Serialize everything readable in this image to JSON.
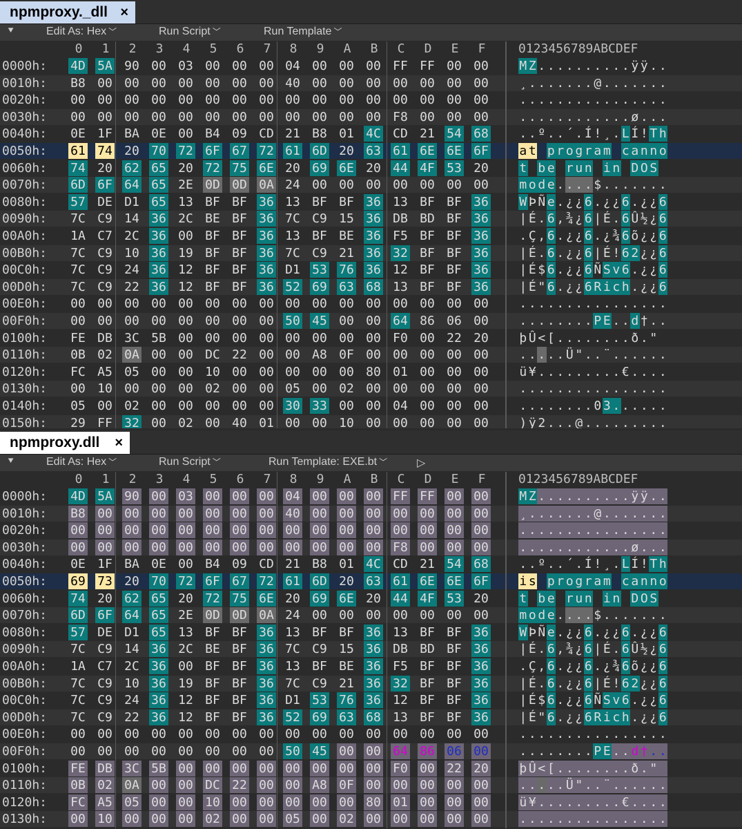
{
  "panes": [
    {
      "tab_label": "npmproxy._dll",
      "close": "×",
      "toolbar": {
        "edit_as": "Edit As: Hex",
        "run_script": "Run Script",
        "run_template": "Run Template"
      },
      "col_headers": [
        "0",
        "1",
        "2",
        "3",
        "4",
        "5",
        "6",
        "7",
        "8",
        "9",
        "A",
        "B",
        "C",
        "D",
        "E",
        "F"
      ],
      "ascii_header": "0123456789ABCDEF",
      "rows": [
        {
          "addr": "0000h:",
          "bytes": [
            "4D",
            "5A",
            "90",
            "00",
            "03",
            "00",
            "00",
            "00",
            "04",
            "00",
            "00",
            "00",
            "FF",
            "FF",
            "00",
            "00"
          ],
          "ascii": "MZ..........ÿÿ.."
        },
        {
          "addr": "0010h:",
          "bytes": [
            "B8",
            "00",
            "00",
            "00",
            "00",
            "00",
            "00",
            "00",
            "40",
            "00",
            "00",
            "00",
            "00",
            "00",
            "00",
            "00"
          ],
          "ascii": "¸.......@......."
        },
        {
          "addr": "0020h:",
          "bytes": [
            "00",
            "00",
            "00",
            "00",
            "00",
            "00",
            "00",
            "00",
            "00",
            "00",
            "00",
            "00",
            "00",
            "00",
            "00",
            "00"
          ],
          "ascii": "................"
        },
        {
          "addr": "0030h:",
          "bytes": [
            "00",
            "00",
            "00",
            "00",
            "00",
            "00",
            "00",
            "00",
            "00",
            "00",
            "00",
            "00",
            "F8",
            "00",
            "00",
            "00"
          ],
          "ascii": "............ø..."
        },
        {
          "addr": "0040h:",
          "bytes": [
            "0E",
            "1F",
            "BA",
            "0E",
            "00",
            "B4",
            "09",
            "CD",
            "21",
            "B8",
            "01",
            "4C",
            "CD",
            "21",
            "54",
            "68"
          ],
          "ascii": "..º..´.Í!¸.LÍ!Th"
        },
        {
          "addr": "0050h:",
          "bytes": [
            "61",
            "74",
            "20",
            "70",
            "72",
            "6F",
            "67",
            "72",
            "61",
            "6D",
            "20",
            "63",
            "61",
            "6E",
            "6E",
            "6F"
          ],
          "ascii": "at program canno"
        },
        {
          "addr": "0060h:",
          "bytes": [
            "74",
            "20",
            "62",
            "65",
            "20",
            "72",
            "75",
            "6E",
            "20",
            "69",
            "6E",
            "20",
            "44",
            "4F",
            "53",
            "20"
          ],
          "ascii": "t be run in DOS "
        },
        {
          "addr": "0070h:",
          "bytes": [
            "6D",
            "6F",
            "64",
            "65",
            "2E",
            "0D",
            "0D",
            "0A",
            "24",
            "00",
            "00",
            "00",
            "00",
            "00",
            "00",
            "00"
          ],
          "ascii": "mode....$......."
        },
        {
          "addr": "0080h:",
          "bytes": [
            "57",
            "DE",
            "D1",
            "65",
            "13",
            "BF",
            "BF",
            "36",
            "13",
            "BF",
            "BF",
            "36",
            "13",
            "BF",
            "BF",
            "36"
          ],
          "ascii": "WÞÑe.¿¿6.¿¿6.¿¿6"
        },
        {
          "addr": "0090h:",
          "bytes": [
            "7C",
            "C9",
            "14",
            "36",
            "2C",
            "BE",
            "BF",
            "36",
            "7C",
            "C9",
            "15",
            "36",
            "DB",
            "BD",
            "BF",
            "36"
          ],
          "ascii": "|É.6,¾¿6|É.6Û½¿6"
        },
        {
          "addr": "00A0h:",
          "bytes": [
            "1A",
            "C7",
            "2C",
            "36",
            "00",
            "BF",
            "BF",
            "36",
            "13",
            "BF",
            "BE",
            "36",
            "F5",
            "BF",
            "BF",
            "36"
          ],
          "ascii": ".Ç,6.¿¿6.¿¾6õ¿¿6"
        },
        {
          "addr": "00B0h:",
          "bytes": [
            "7C",
            "C9",
            "10",
            "36",
            "19",
            "BF",
            "BF",
            "36",
            "7C",
            "C9",
            "21",
            "36",
            "32",
            "BF",
            "BF",
            "36"
          ],
          "ascii": "|É.6.¿¿6|É!62¿¿6"
        },
        {
          "addr": "00C0h:",
          "bytes": [
            "7C",
            "C9",
            "24",
            "36",
            "12",
            "BF",
            "BF",
            "36",
            "D1",
            "53",
            "76",
            "36",
            "12",
            "BF",
            "BF",
            "36"
          ],
          "ascii": "|É$6.¿¿6ÑSv6.¿¿6"
        },
        {
          "addr": "00D0h:",
          "bytes": [
            "7C",
            "C9",
            "22",
            "36",
            "12",
            "BF",
            "BF",
            "36",
            "52",
            "69",
            "63",
            "68",
            "13",
            "BF",
            "BF",
            "36"
          ],
          "ascii": "|É\"6.¿¿6Rich.¿¿6"
        },
        {
          "addr": "00E0h:",
          "bytes": [
            "00",
            "00",
            "00",
            "00",
            "00",
            "00",
            "00",
            "00",
            "00",
            "00",
            "00",
            "00",
            "00",
            "00",
            "00",
            "00"
          ],
          "ascii": "................"
        },
        {
          "addr": "00F0h:",
          "bytes": [
            "00",
            "00",
            "00",
            "00",
            "00",
            "00",
            "00",
            "00",
            "50",
            "45",
            "00",
            "00",
            "64",
            "86",
            "06",
            "00"
          ],
          "ascii": "........PE..d†.."
        },
        {
          "addr": "0100h:",
          "bytes": [
            "FE",
            "DB",
            "3C",
            "5B",
            "00",
            "00",
            "00",
            "00",
            "00",
            "00",
            "00",
            "00",
            "F0",
            "00",
            "22",
            "20"
          ],
          "ascii": "þÛ<[........ð.\" "
        },
        {
          "addr": "0110h:",
          "bytes": [
            "0B",
            "02",
            "0A",
            "00",
            "00",
            "DC",
            "22",
            "00",
            "00",
            "A8",
            "0F",
            "00",
            "00",
            "00",
            "00",
            "00"
          ],
          "ascii": ".....Ü\"..¨......"
        },
        {
          "addr": "0120h:",
          "bytes": [
            "FC",
            "A5",
            "05",
            "00",
            "00",
            "10",
            "00",
            "00",
            "00",
            "00",
            "00",
            "80",
            "01",
            "00",
            "00",
            "00"
          ],
          "ascii": "ü¥.........€...."
        },
        {
          "addr": "0130h:",
          "bytes": [
            "00",
            "10",
            "00",
            "00",
            "00",
            "02",
            "00",
            "00",
            "05",
            "00",
            "02",
            "00",
            "00",
            "00",
            "00",
            "00"
          ],
          "ascii": "................"
        },
        {
          "addr": "0140h:",
          "bytes": [
            "05",
            "00",
            "02",
            "00",
            "00",
            "00",
            "00",
            "00",
            "30",
            "33",
            "00",
            "00",
            "04",
            "00",
            "00",
            "00"
          ],
          "ascii": "........03......"
        },
        {
          "addr": "0150h:",
          "bytes": [
            "29",
            "FF",
            "32",
            "00",
            "02",
            "00",
            "40",
            "01",
            "00",
            "00",
            "10",
            "00",
            "00",
            "00",
            "00",
            "00"
          ],
          "ascii": ")ÿ2...@........."
        }
      ]
    },
    {
      "tab_label": "npmproxy.dll",
      "close": "×",
      "toolbar": {
        "edit_as": "Edit As: Hex",
        "run_script": "Run Script",
        "run_template": "Run Template: EXE.bt",
        "play": "▷"
      },
      "col_headers": [
        "0",
        "1",
        "2",
        "3",
        "4",
        "5",
        "6",
        "7",
        "8",
        "9",
        "A",
        "B",
        "C",
        "D",
        "E",
        "F"
      ],
      "ascii_header": "0123456789ABCDEF",
      "rows": [
        {
          "addr": "0000h:",
          "bytes": [
            "4D",
            "5A",
            "90",
            "00",
            "03",
            "00",
            "00",
            "00",
            "04",
            "00",
            "00",
            "00",
            "FF",
            "FF",
            "00",
            "00"
          ],
          "ascii": "MZ..........ÿÿ.."
        },
        {
          "addr": "0010h:",
          "bytes": [
            "B8",
            "00",
            "00",
            "00",
            "00",
            "00",
            "00",
            "00",
            "40",
            "00",
            "00",
            "00",
            "00",
            "00",
            "00",
            "00"
          ],
          "ascii": "¸.......@......."
        },
        {
          "addr": "0020h:",
          "bytes": [
            "00",
            "00",
            "00",
            "00",
            "00",
            "00",
            "00",
            "00",
            "00",
            "00",
            "00",
            "00",
            "00",
            "00",
            "00",
            "00"
          ],
          "ascii": "................"
        },
        {
          "addr": "0030h:",
          "bytes": [
            "00",
            "00",
            "00",
            "00",
            "00",
            "00",
            "00",
            "00",
            "00",
            "00",
            "00",
            "00",
            "F8",
            "00",
            "00",
            "00"
          ],
          "ascii": "............ø..."
        },
        {
          "addr": "0040h:",
          "bytes": [
            "0E",
            "1F",
            "BA",
            "0E",
            "00",
            "B4",
            "09",
            "CD",
            "21",
            "B8",
            "01",
            "4C",
            "CD",
            "21",
            "54",
            "68"
          ],
          "ascii": "..º..´.Í!¸.LÍ!Th"
        },
        {
          "addr": "0050h:",
          "bytes": [
            "69",
            "73",
            "20",
            "70",
            "72",
            "6F",
            "67",
            "72",
            "61",
            "6D",
            "20",
            "63",
            "61",
            "6E",
            "6E",
            "6F"
          ],
          "ascii": "is program canno"
        },
        {
          "addr": "0060h:",
          "bytes": [
            "74",
            "20",
            "62",
            "65",
            "20",
            "72",
            "75",
            "6E",
            "20",
            "69",
            "6E",
            "20",
            "44",
            "4F",
            "53",
            "20"
          ],
          "ascii": "t be run in DOS "
        },
        {
          "addr": "0070h:",
          "bytes": [
            "6D",
            "6F",
            "64",
            "65",
            "2E",
            "0D",
            "0D",
            "0A",
            "24",
            "00",
            "00",
            "00",
            "00",
            "00",
            "00",
            "00"
          ],
          "ascii": "mode....$......."
        },
        {
          "addr": "0080h:",
          "bytes": [
            "57",
            "DE",
            "D1",
            "65",
            "13",
            "BF",
            "BF",
            "36",
            "13",
            "BF",
            "BF",
            "36",
            "13",
            "BF",
            "BF",
            "36"
          ],
          "ascii": "WÞÑe.¿¿6.¿¿6.¿¿6"
        },
        {
          "addr": "0090h:",
          "bytes": [
            "7C",
            "C9",
            "14",
            "36",
            "2C",
            "BE",
            "BF",
            "36",
            "7C",
            "C9",
            "15",
            "36",
            "DB",
            "BD",
            "BF",
            "36"
          ],
          "ascii": "|É.6,¾¿6|É.6Û½¿6"
        },
        {
          "addr": "00A0h:",
          "bytes": [
            "1A",
            "C7",
            "2C",
            "36",
            "00",
            "BF",
            "BF",
            "36",
            "13",
            "BF",
            "BE",
            "36",
            "F5",
            "BF",
            "BF",
            "36"
          ],
          "ascii": ".Ç,6.¿¿6.¿¾6õ¿¿6"
        },
        {
          "addr": "00B0h:",
          "bytes": [
            "7C",
            "C9",
            "10",
            "36",
            "19",
            "BF",
            "BF",
            "36",
            "7C",
            "C9",
            "21",
            "36",
            "32",
            "BF",
            "BF",
            "36"
          ],
          "ascii": "|É.6.¿¿6|É!62¿¿6"
        },
        {
          "addr": "00C0h:",
          "bytes": [
            "7C",
            "C9",
            "24",
            "36",
            "12",
            "BF",
            "BF",
            "36",
            "D1",
            "53",
            "76",
            "36",
            "12",
            "BF",
            "BF",
            "36"
          ],
          "ascii": "|É$6.¿¿6ÑSv6.¿¿6"
        },
        {
          "addr": "00D0h:",
          "bytes": [
            "7C",
            "C9",
            "22",
            "36",
            "12",
            "BF",
            "BF",
            "36",
            "52",
            "69",
            "63",
            "68",
            "13",
            "BF",
            "BF",
            "36"
          ],
          "ascii": "|É\"6.¿¿6Rich.¿¿6"
        },
        {
          "addr": "00E0h:",
          "bytes": [
            "00",
            "00",
            "00",
            "00",
            "00",
            "00",
            "00",
            "00",
            "00",
            "00",
            "00",
            "00",
            "00",
            "00",
            "00",
            "00"
          ],
          "ascii": "................"
        },
        {
          "addr": "00F0h:",
          "bytes": [
            "00",
            "00",
            "00",
            "00",
            "00",
            "00",
            "00",
            "00",
            "50",
            "45",
            "00",
            "00",
            "64",
            "86",
            "06",
            "00"
          ],
          "ascii": "........PE..d†.."
        },
        {
          "addr": "0100h:",
          "bytes": [
            "FE",
            "DB",
            "3C",
            "5B",
            "00",
            "00",
            "00",
            "00",
            "00",
            "00",
            "00",
            "00",
            "F0",
            "00",
            "22",
            "20"
          ],
          "ascii": "þÛ<[........ð.\" "
        },
        {
          "addr": "0110h:",
          "bytes": [
            "0B",
            "02",
            "0A",
            "00",
            "00",
            "DC",
            "22",
            "00",
            "00",
            "A8",
            "0F",
            "00",
            "00",
            "00",
            "00",
            "00"
          ],
          "ascii": ".....Ü\"..¨......"
        },
        {
          "addr": "0120h:",
          "bytes": [
            "FC",
            "A5",
            "05",
            "00",
            "00",
            "10",
            "00",
            "00",
            "00",
            "00",
            "00",
            "80",
            "01",
            "00",
            "00",
            "00"
          ],
          "ascii": "ü¥.........€...."
        },
        {
          "addr": "0130h:",
          "bytes": [
            "00",
            "10",
            "00",
            "00",
            "00",
            "02",
            "00",
            "00",
            "05",
            "00",
            "02",
            "00",
            "00",
            "00",
            "00",
            "00"
          ],
          "ascii": "................"
        }
      ]
    }
  ],
  "colors": {
    "background": "#2b2b2b",
    "row_alt": "#343434",
    "teal_highlight": "#0b7b7b",
    "yellow_highlight": "#fbe7a6",
    "gray_highlight": "#6a6a6a",
    "template_purple": "#6e6577",
    "active_row": "#1e2e48",
    "tab_active": "#ffffff",
    "tab_inactive": "#c9d9ef",
    "magenta_text": "#d500d5",
    "blue_text": "#1e2ec0"
  }
}
